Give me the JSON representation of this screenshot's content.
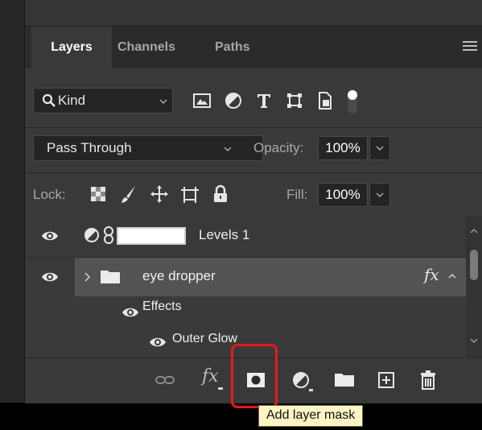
{
  "tabs": [
    {
      "label": "Layers",
      "active": true
    },
    {
      "label": "Channels",
      "active": false
    },
    {
      "label": "Paths",
      "active": false
    }
  ],
  "filter": {
    "kind_label": "Kind",
    "icons": [
      "image-filter-icon",
      "adjustment-filter-icon",
      "type-filter-icon",
      "shape-filter-icon",
      "smart-object-filter-icon",
      "filter-toggle-icon"
    ]
  },
  "blend": {
    "mode": "Pass Through",
    "opacity_label": "Opacity:",
    "opacity_value": "100%"
  },
  "lock": {
    "label": "Lock:",
    "icons": [
      "lock-transparent-pixels-icon",
      "lock-image-pixels-icon",
      "lock-position-icon",
      "lock-artboard-icon",
      "lock-all-icon"
    ],
    "fill_label": "Fill:",
    "fill_value": "100%"
  },
  "layers": [
    {
      "name": "Levels 1",
      "type": "adjustment"
    },
    {
      "name": "eye dropper",
      "type": "group",
      "fx": "fx"
    },
    {
      "name": "Effects",
      "type": "effects"
    },
    {
      "name": "Outer Glow",
      "type": "effect"
    }
  ],
  "toolbar": {
    "icons": [
      "link-layers-icon",
      "add-layer-style-icon",
      "add-layer-mask-icon",
      "new-adjustment-layer-icon",
      "new-group-icon",
      "new-layer-icon",
      "delete-layer-icon"
    ],
    "fx_label": "fx"
  },
  "tooltip": "Add layer mask",
  "colors": {
    "panel_bg": "#393939",
    "selected_row": "#535353",
    "highlight": "#e51a1a",
    "tooltip_bg": "#fbf5c5"
  }
}
